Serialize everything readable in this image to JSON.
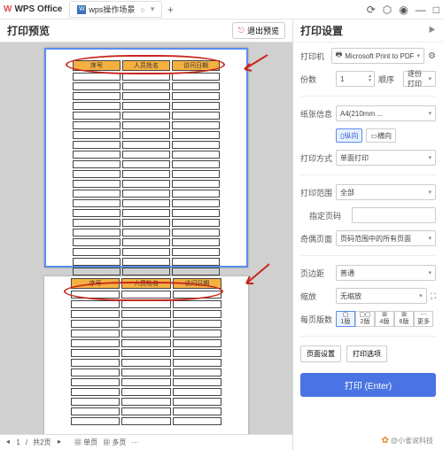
{
  "titlebar": {
    "app": "WPS Office",
    "tab_name": "wps操作场景",
    "tab_badge": "W",
    "tab_mark": "○",
    "add": "+",
    "icons": [
      "⟳",
      "⬡",
      "◉",
      "—",
      "□"
    ]
  },
  "left": {
    "title": "打印预览",
    "exit_label": "退出预览",
    "table_headers": [
      "序号",
      "人员姓名",
      "访问日期"
    ],
    "bottom": {
      "page": "1",
      "sep": "/",
      "total": "共2页",
      "items": [
        "▦ 单页",
        "▦ 多页",
        "···"
      ]
    }
  },
  "panel": {
    "title": "打印设置",
    "printer": {
      "label": "打印机",
      "value": "Microsoft Print to PDF",
      "gear": "⚙"
    },
    "copies": {
      "label": "份数",
      "value": "1",
      "order_label": "顺序",
      "order_value": "逐份打印"
    },
    "paper": {
      "label": "纸张信息",
      "value": "A4(210mm ...",
      "orient1": "纵向",
      "orient2": "横向"
    },
    "mode": {
      "label": "打印方式",
      "value": "单面打印"
    },
    "range": {
      "label": "打印范围",
      "value": "全部"
    },
    "pages_spec": {
      "label": "指定页码"
    },
    "odd_even": {
      "label": "奇偶页面",
      "value": "页码范围中的所有页面"
    },
    "margin": {
      "label": "页边距",
      "value": "普通"
    },
    "scale": {
      "label": "缩放",
      "value": "无缩放"
    },
    "per_sheet": {
      "label": "每页版数",
      "opts": [
        "1版",
        "2版",
        "4版",
        "6版",
        "更多"
      ]
    },
    "btns": {
      "page_setup": "页面设置",
      "options": "打印选项"
    },
    "print": "打印 (Enter)"
  },
  "watermark": "@小雀说科技"
}
